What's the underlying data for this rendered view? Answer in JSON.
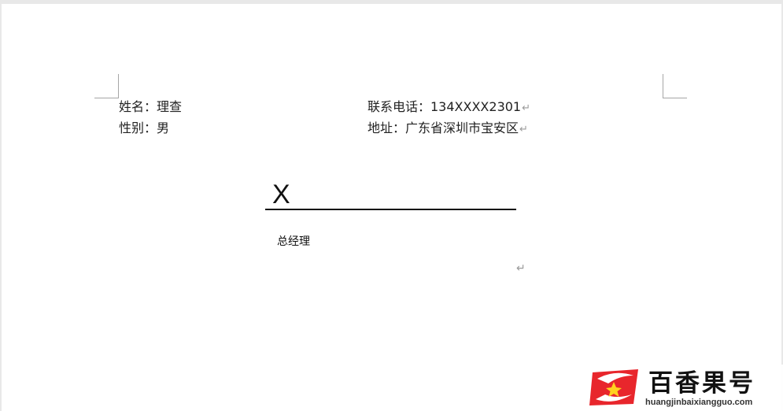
{
  "document": {
    "name_field": "姓名：理查",
    "gender_field": "性别：男",
    "phone_field": "联系电话：134XXXX2301",
    "address_field": "地址：广东省深圳市宝安区",
    "paragraph_mark": "↵",
    "signature_x": "X",
    "signature_title": "总经理"
  },
  "watermark": {
    "name": "百香果号",
    "url": "huangjinbaixiangguo.com",
    "brand_color": "#e8262c"
  }
}
